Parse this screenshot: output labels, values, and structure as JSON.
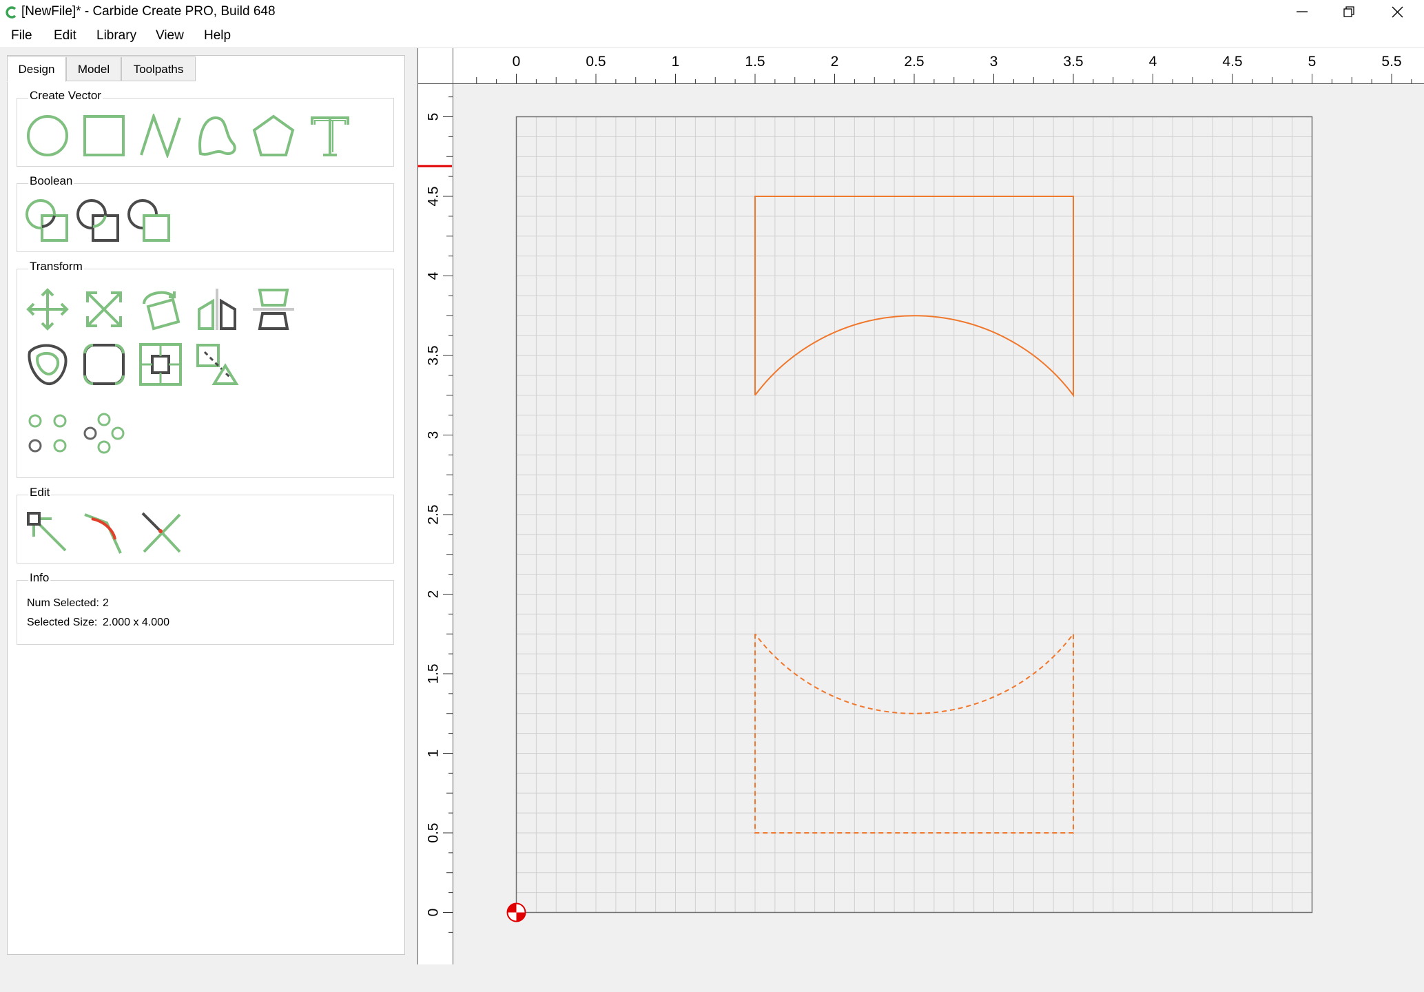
{
  "window": {
    "title": "[NewFile]* - Carbide Create PRO, Build 648",
    "minimize_icon": "minimize-icon",
    "restore_icon": "restore-icon",
    "close_icon": "close-icon"
  },
  "menu": {
    "items": [
      "File",
      "Edit",
      "Library",
      "View",
      "Help"
    ]
  },
  "tabs": [
    "Design",
    "Model",
    "Toolpaths"
  ],
  "active_tab": "Design",
  "groups": {
    "create_vector": {
      "title": "Create Vector",
      "tools": [
        "circle-icon",
        "rectangle-icon",
        "polyline-icon",
        "curve-icon",
        "polygon-icon",
        "text-icon"
      ]
    },
    "boolean": {
      "title": "Boolean",
      "tools": [
        "union-icon",
        "subtract-icon",
        "intersect-icon"
      ]
    },
    "transform": {
      "title": "Transform",
      "tools": [
        "move-icon",
        "scale-icon",
        "rotate-icon",
        "mirror-icon",
        "align-icon",
        "offset-icon",
        "fillet-icon",
        "center-icon",
        "flip-icon",
        "rectangular-array-icon",
        "circular-array-icon"
      ]
    },
    "edit": {
      "title": "Edit",
      "tools": [
        "node-edit-icon",
        "smooth-node-icon",
        "trim-icon"
      ]
    },
    "info": {
      "title": "Info",
      "num_selected_label": "Num Selected:",
      "num_selected_value": "2",
      "selected_size_label": "Selected Size:",
      "selected_size_value": "2.000 x 4.000"
    }
  },
  "colors": {
    "accent_green": "#7fbf7f",
    "dark_gray": "#4a4a4a",
    "selection_orange": "#f0782d",
    "origin_red": "#e00000",
    "grid": "#d0d0d0"
  },
  "ruler": {
    "x_labels": [
      "0",
      "0.5",
      "1",
      "1.5",
      "2",
      "2.5",
      "3",
      "3.5",
      "4",
      "4.5",
      "5",
      "5.5"
    ],
    "y_labels": [
      "0",
      "0.5",
      "1",
      "1.5",
      "2",
      "2.5",
      "3",
      "3.5",
      "4",
      "4.5",
      "5"
    ],
    "y_marker": 4.69
  },
  "workspace": {
    "stock_width": 5,
    "stock_height": 5,
    "grid_step": 0.125,
    "shapes": [
      {
        "name": "top-shape",
        "dashed": false,
        "rect": [
          1.5,
          3.25,
          3.5,
          4.5
        ],
        "arc_peak": 3.75
      },
      {
        "name": "bottom-shape",
        "dashed": true,
        "rect": [
          1.5,
          0.5,
          3.5,
          1.75
        ],
        "arc_peak": 1.25
      }
    ]
  }
}
